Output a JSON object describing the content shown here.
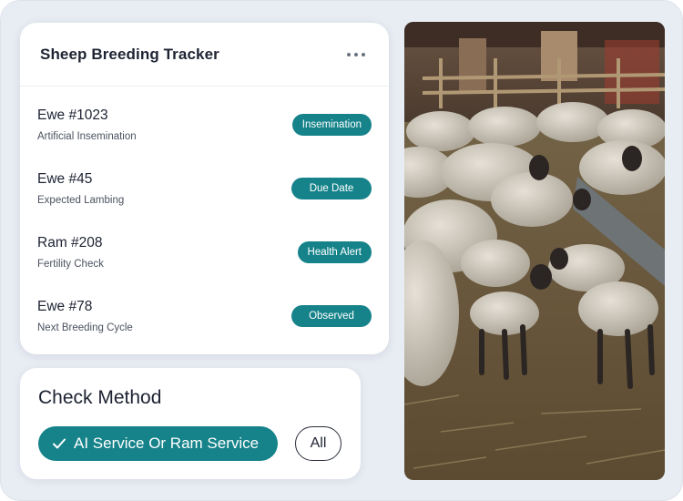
{
  "tracker": {
    "title": "Sheep Breeding Tracker",
    "menu_icon": "more-horizontal-icon",
    "entries": [
      {
        "name": "Ewe #1023",
        "detail": "Artificial Insemination",
        "status": "Insemination"
      },
      {
        "name": "Ewe #45",
        "detail": "Expected Lambing",
        "status": "Due Date"
      },
      {
        "name": "Ram #208",
        "detail": "Fertility Check",
        "status": "Health Alert"
      },
      {
        "name": "Ewe #78",
        "detail": "Next Breeding Cycle",
        "status": "Observed"
      }
    ]
  },
  "check_method": {
    "title": "Check Method",
    "selected_option": "AI Service Or Ram Service",
    "selected_icon": "checkmark-icon",
    "other_option": "All"
  },
  "colors": {
    "accent": "#16838a",
    "background": "#e8ecf3",
    "card": "#ffffff",
    "text": "#1d2232"
  },
  "photo": {
    "subject": "sheep-and-lambs-in-barn-photo"
  }
}
